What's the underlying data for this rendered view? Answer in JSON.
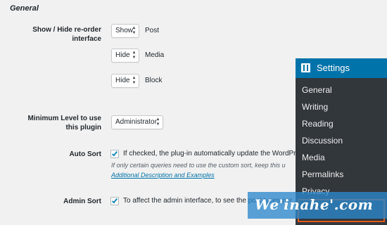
{
  "section_title": "General",
  "reorder": {
    "label": "Show / Hide re-order interface",
    "rows": [
      {
        "value": "Show",
        "label": "Post"
      },
      {
        "value": "Hide",
        "label": "Media"
      },
      {
        "value": "Hide",
        "label": "Block"
      }
    ]
  },
  "min_level": {
    "label": "Minimum Level to use this plugin",
    "value": "Administrator"
  },
  "auto_sort": {
    "label": "Auto Sort",
    "checked": true,
    "text": "If checked, the plug-in automatically update the WordPress",
    "desc": "If only certain queries need to use the custom sort, keep this u",
    "link": "Additional Description and Examples"
  },
  "admin_sort": {
    "label": "Admin Sort",
    "checked": true,
    "text": "To affect the admin interface, to see the post types per"
  },
  "admin_menu": {
    "title": "Settings",
    "items": [
      "General",
      "Writing",
      "Reading",
      "Discussion",
      "Media",
      "Permalinks",
      "Privacy"
    ]
  },
  "watermark": "We'inahe'.com",
  "colors": {
    "menu_bg": "#32373c",
    "menu_head": "#0073aa",
    "highlight": "#e05a1a",
    "link": "#0073aa"
  }
}
